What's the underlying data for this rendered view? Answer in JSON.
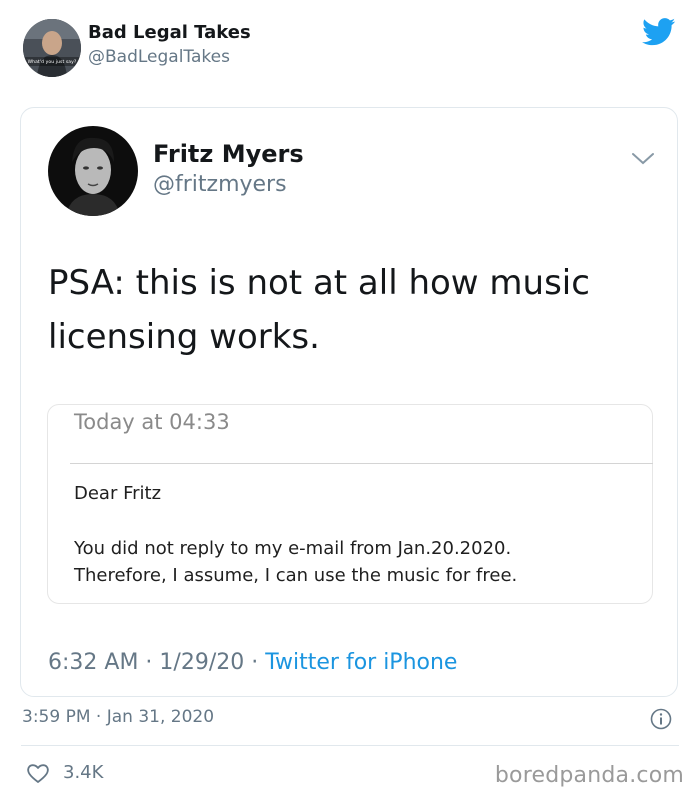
{
  "outer_tweet": {
    "author_name": "Bad Legal Takes",
    "author_handle": "@BadLegalTakes",
    "avatar_caption": "What'd you just say?",
    "timestamp": "3:59 PM · Jan 31, 2020",
    "like_count": "3.4K"
  },
  "quoted_tweet": {
    "author_name": "Fritz Myers",
    "author_handle": "@fritzmyers",
    "text": "PSA: this is not at all how music licensing works.",
    "time": "6:32 AM",
    "date": "1/29/20",
    "separator": " · ",
    "source": "Twitter for iPhone"
  },
  "email": {
    "time": "Today at 04:33",
    "greeting": "Dear Fritz",
    "body_line1": "You did not reply to my e-mail from Jan.20.2020.",
    "body_line2": "Therefore, I assume, I can use the music for free."
  },
  "watermark": "boredpanda.com",
  "colors": {
    "twitter_blue": "#1da1f2",
    "link_blue": "#1b95e0",
    "secondary_text": "#657786",
    "border": "#e1e8ed"
  },
  "icons": [
    "twitter-bird-icon",
    "chevron-down-icon",
    "info-icon",
    "heart-icon"
  ]
}
